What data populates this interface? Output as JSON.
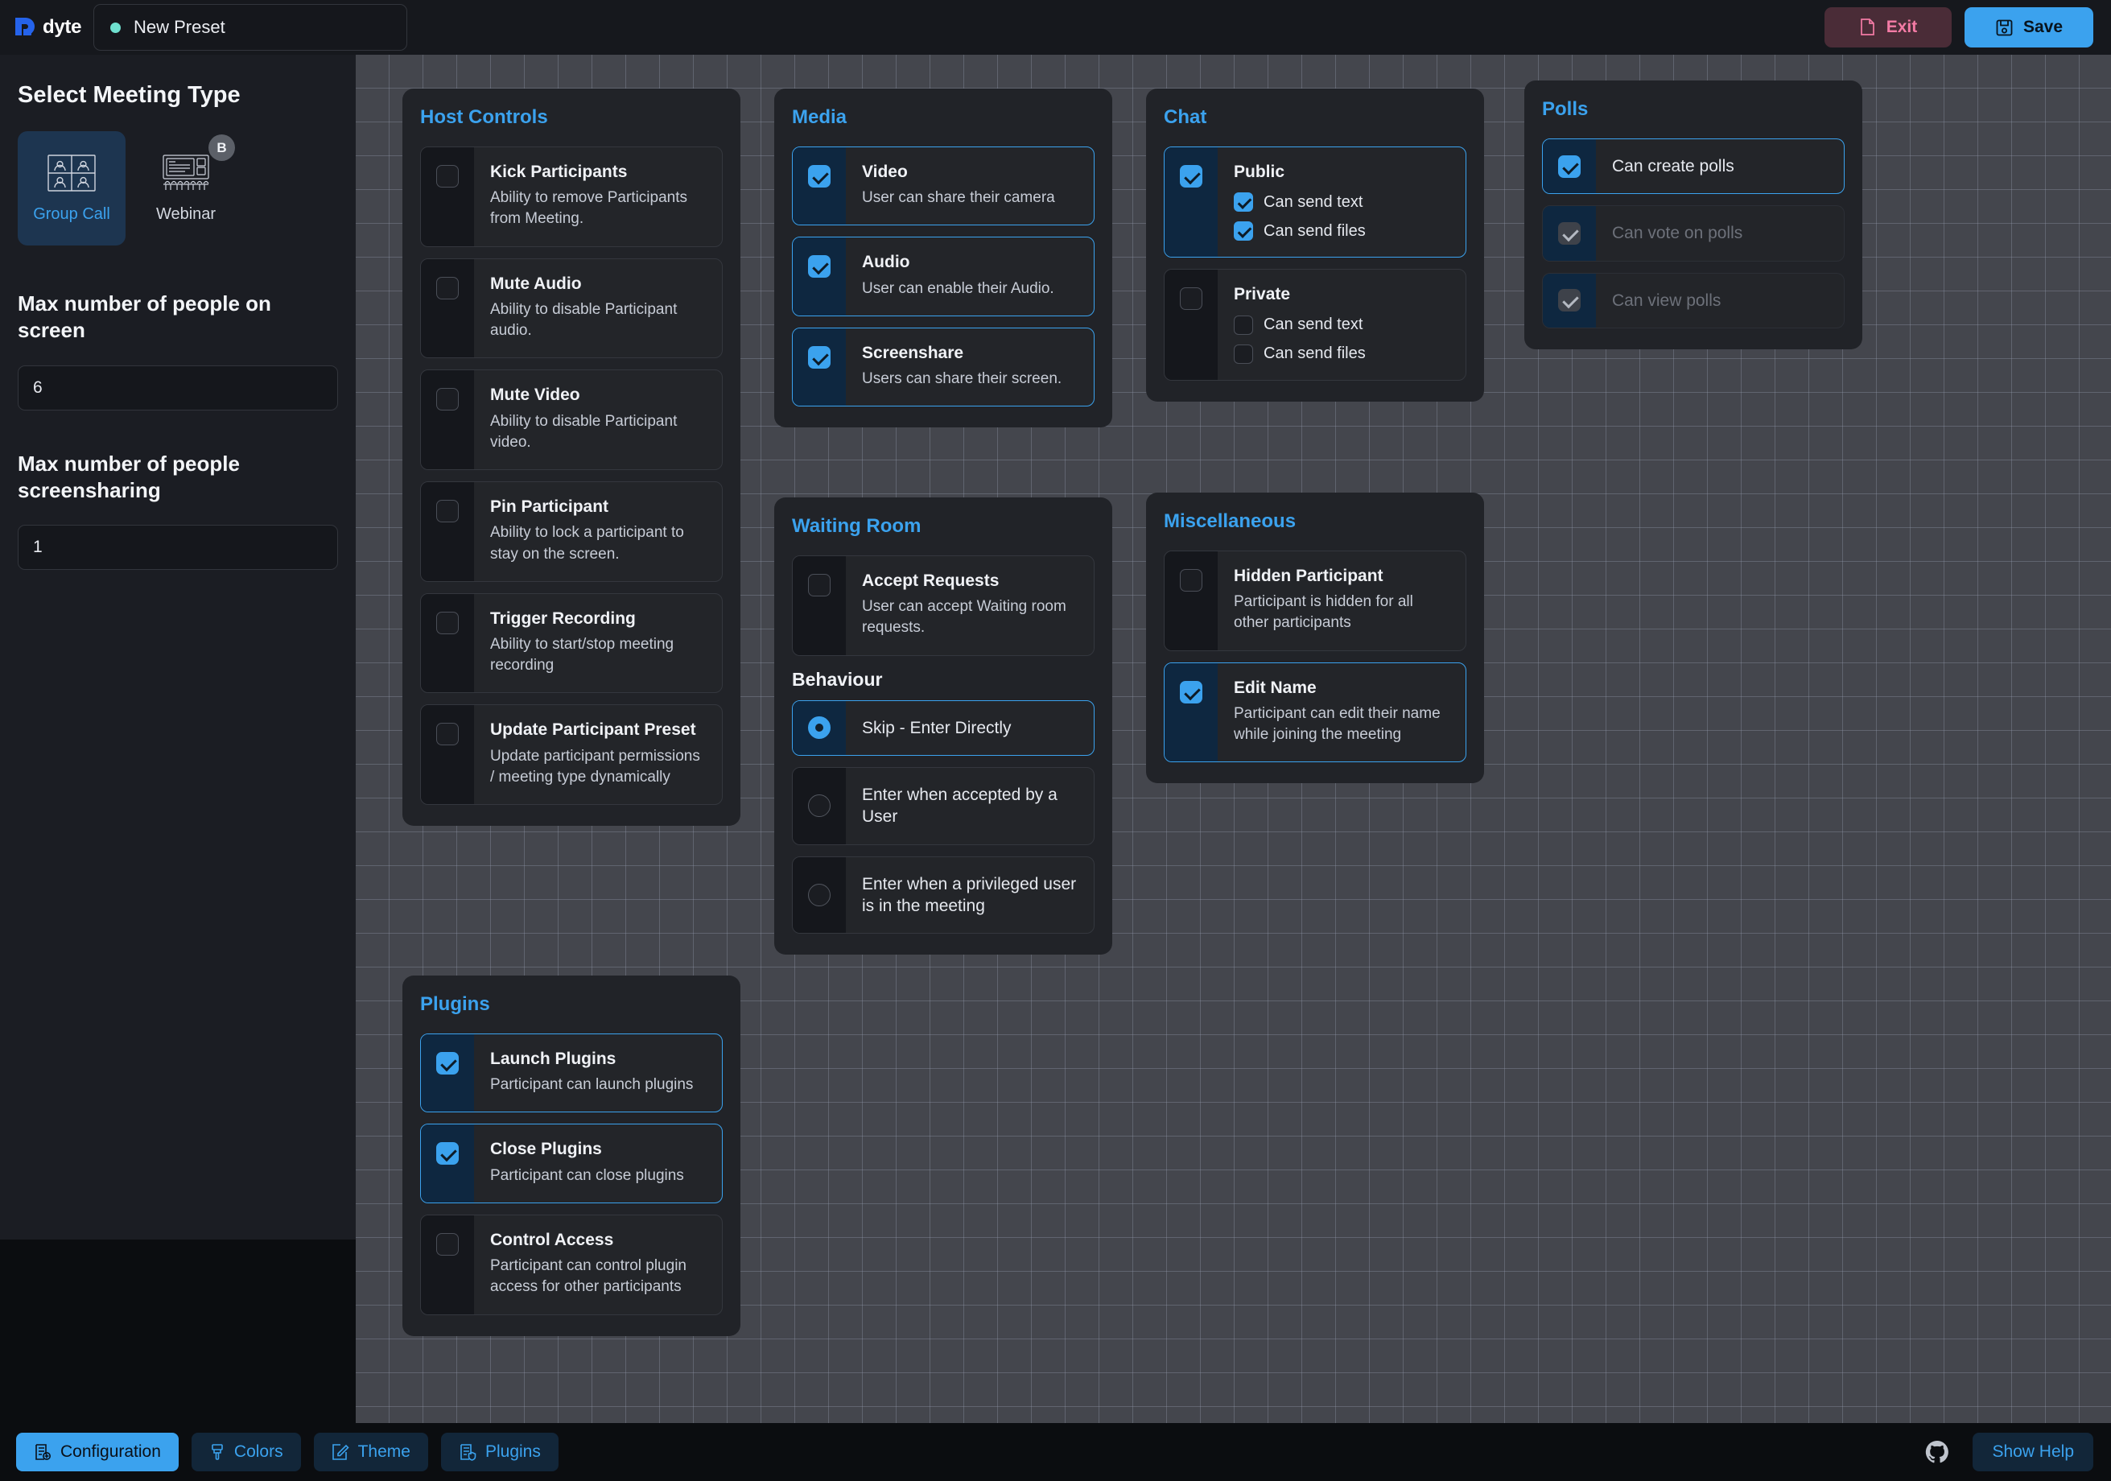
{
  "topbar": {
    "brand_name": "dyte",
    "preset_name": "New Preset",
    "exit_label": "Exit",
    "save_label": "Save"
  },
  "sidebar": {
    "meeting_type_heading": "Select Meeting Type",
    "meeting_types": [
      {
        "label": "Group Call",
        "selected": true,
        "badge": ""
      },
      {
        "label": "Webinar",
        "selected": false,
        "badge": "B"
      }
    ],
    "max_people_on_screen_label": "Max number of people on screen",
    "max_people_on_screen_value": "6",
    "max_screensharing_label": "Max number of people screensharing",
    "max_screensharing_value": "1"
  },
  "panels": {
    "host_controls": {
      "title": "Host Controls",
      "items": [
        {
          "title": "Kick Participants",
          "desc": "Ability to remove Participants from Meeting.",
          "checked": false
        },
        {
          "title": "Mute Audio",
          "desc": "Ability to disable Participant audio.",
          "checked": false
        },
        {
          "title": "Mute Video",
          "desc": "Ability to disable Participant video.",
          "checked": false
        },
        {
          "title": "Pin Participant",
          "desc": "Ability to lock a participant to stay on the screen.",
          "checked": false
        },
        {
          "title": "Trigger Recording",
          "desc": "Ability to start/stop meeting recording",
          "checked": false
        },
        {
          "title": "Update Participant Preset",
          "desc": "Update participant permissions / meeting type dynamically",
          "checked": false
        }
      ]
    },
    "media": {
      "title": "Media",
      "items": [
        {
          "title": "Video",
          "desc": "User can share their camera",
          "checked": true
        },
        {
          "title": "Audio",
          "desc": "User can enable their Audio.",
          "checked": true
        },
        {
          "title": "Screenshare",
          "desc": "Users can share their screen.",
          "checked": true
        }
      ]
    },
    "chat": {
      "title": "Chat",
      "groups": [
        {
          "title": "Public",
          "checked": true,
          "subs": [
            {
              "label": "Can send text",
              "checked": true
            },
            {
              "label": "Can send files",
              "checked": true
            }
          ]
        },
        {
          "title": "Private",
          "checked": false,
          "subs": [
            {
              "label": "Can send text",
              "checked": false
            },
            {
              "label": "Can send files",
              "checked": false
            }
          ]
        }
      ]
    },
    "polls": {
      "title": "Polls",
      "items": [
        {
          "label": "Can create polls",
          "checked": true,
          "disabled": false
        },
        {
          "label": "Can vote on polls",
          "checked": true,
          "disabled": true
        },
        {
          "label": "Can view polls",
          "checked": true,
          "disabled": true
        }
      ]
    },
    "waiting_room": {
      "title": "Waiting Room",
      "accept": {
        "title": "Accept Requests",
        "desc": "User can accept Waiting room requests.",
        "checked": false
      },
      "behaviour_label": "Behaviour",
      "behaviour_options": [
        {
          "label": "Skip - Enter Directly",
          "selected": true
        },
        {
          "label": "Enter when accepted by a User",
          "selected": false
        },
        {
          "label": "Enter when a privileged user is in the meeting",
          "selected": false
        }
      ]
    },
    "miscellaneous": {
      "title": "Miscellaneous",
      "items": [
        {
          "title": "Hidden Participant",
          "desc": "Participant is hidden for all other participants",
          "checked": false
        },
        {
          "title": "Edit Name",
          "desc": "Participant can edit their name while joining the meeting",
          "checked": true
        }
      ]
    },
    "plugins": {
      "title": "Plugins",
      "items": [
        {
          "title": "Launch Plugins",
          "desc": "Participant can launch plugins",
          "checked": true
        },
        {
          "title": "Close Plugins",
          "desc": "Participant can close plugins",
          "checked": true
        },
        {
          "title": "Control Access",
          "desc": "Participant can control plugin access for other participants",
          "checked": false
        }
      ]
    }
  },
  "bottombar": {
    "tabs": [
      {
        "label": "Configuration",
        "active": true
      },
      {
        "label": "Colors",
        "active": false
      },
      {
        "label": "Theme",
        "active": false
      },
      {
        "label": "Plugins",
        "active": false
      }
    ],
    "help_label": "Show Help"
  },
  "colors": {
    "accent": "#3ba2ee",
    "exit_bg": "#4a2c37",
    "exit_text": "#f47ba5",
    "preset_dot": "#6fe0cf",
    "panel_bg": "#212328",
    "canvas_bg": "#44464d"
  }
}
